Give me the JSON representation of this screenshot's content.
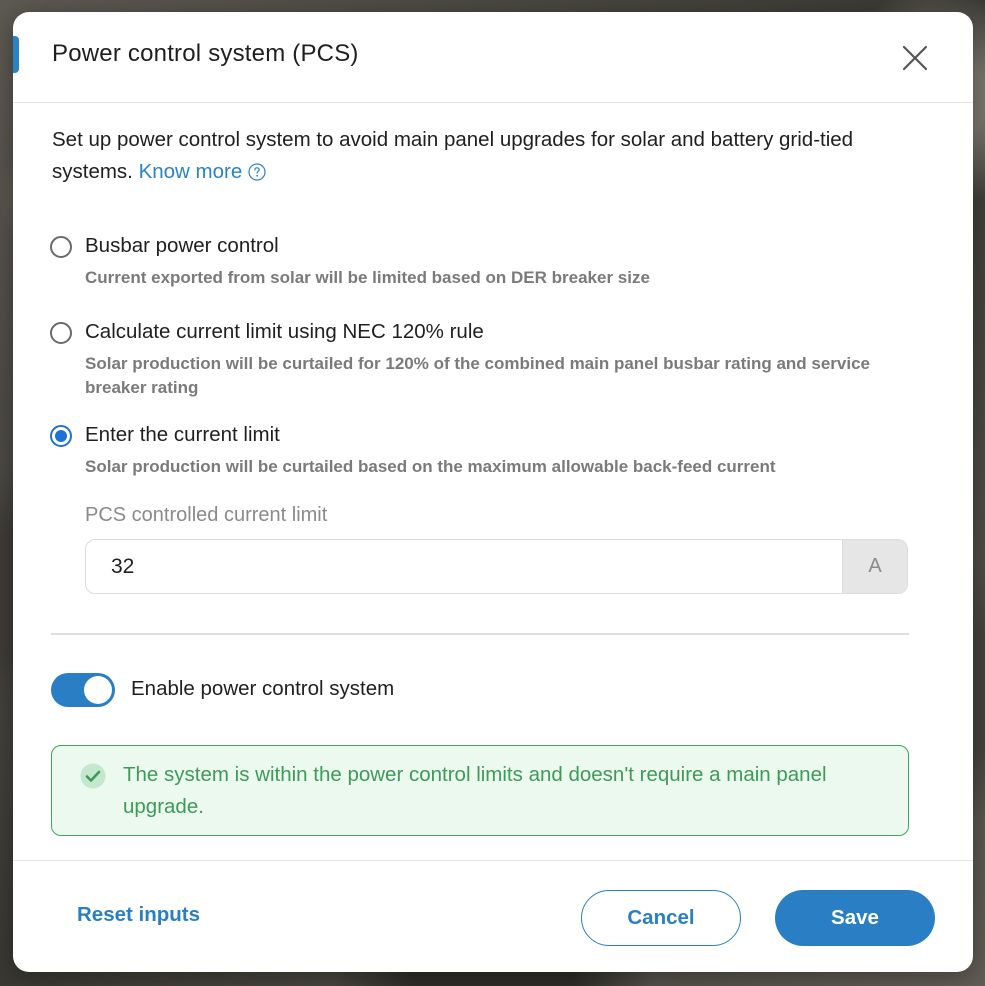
{
  "dialog": {
    "title": "Power control system (PCS)",
    "intro_text": "Set up power control system to avoid main panel upgrades for solar and battery grid-tied systems.",
    "know_more_link": "Know more"
  },
  "options": [
    {
      "label": "Busbar power control",
      "description": "Current exported from solar will be limited based on DER breaker size",
      "selected": false
    },
    {
      "label": "Calculate current limit using NEC 120% rule",
      "description": "Solar production will be curtailed for 120% of the combined main panel busbar rating and service breaker rating",
      "selected": false
    },
    {
      "label": "Enter the current limit",
      "description": "Solar production will be curtailed based on the maximum allowable back-feed current",
      "selected": true
    }
  ],
  "current_limit": {
    "label": "PCS controlled current limit",
    "value": "32",
    "unit": "A"
  },
  "toggle": {
    "label": "Enable power control system",
    "enabled": true
  },
  "status_alert": {
    "text": "The system is within the power control limits and doesn't require a main panel upgrade.",
    "icon": "check-circle-icon"
  },
  "footer": {
    "reset_label": "Reset inputs",
    "cancel_label": "Cancel",
    "save_label": "Save"
  },
  "colors": {
    "accent": "#2a7fc4",
    "radio_selected": "#1d72d6",
    "success": "#3f9a58",
    "success_bg": "#ebf9ee"
  }
}
